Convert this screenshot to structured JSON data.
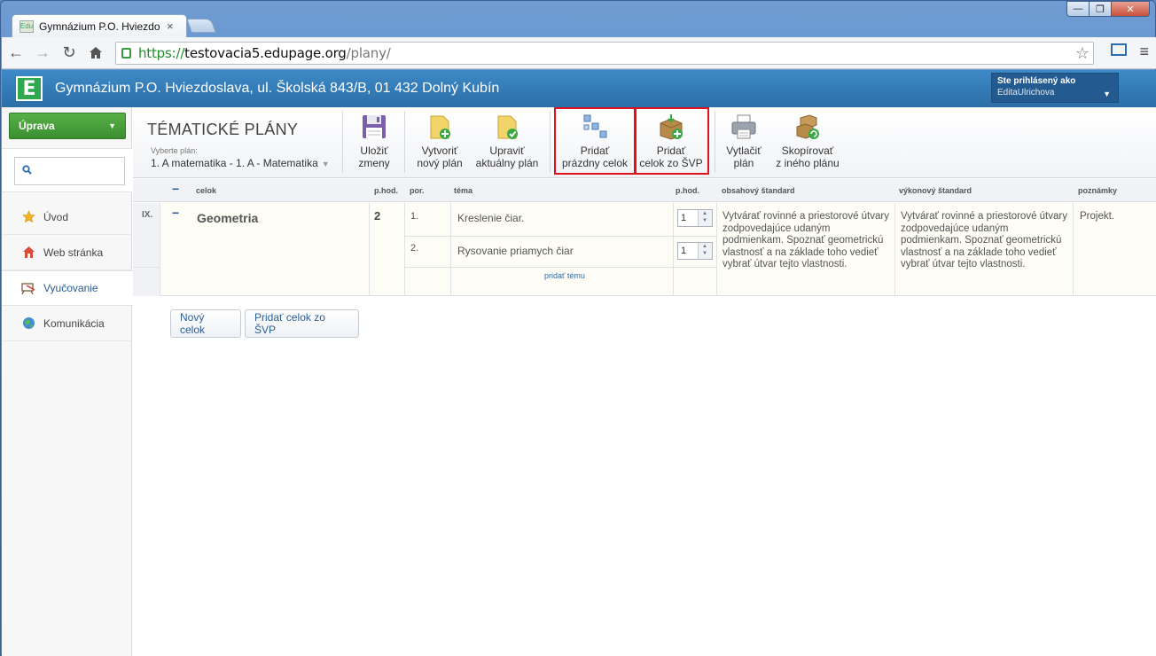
{
  "browser": {
    "tab_title": "Gymnázium P.O. Hviezdo",
    "favicon_text": "Edu",
    "close_glyph": "×",
    "window_buttons": [
      "—",
      "❐",
      "✕"
    ],
    "url_scheme": "https://",
    "url_host": "testovacia5.edupage.org",
    "url_path": "/plany/"
  },
  "header": {
    "logo_letter": "E",
    "school_name": "Gymnázium P.O. Hviezdoslava, ul. Školská 843/B, 01 432 Dolný Kubín",
    "user_label": "Ste prihlásený ako",
    "user_name": "EditaUlrichova"
  },
  "sidebar": {
    "uprava_label": "Úprava",
    "search_placeholder": "",
    "items": [
      {
        "label": "Úvod",
        "icon": "star-icon"
      },
      {
        "label": "Web stránka",
        "icon": "house-icon"
      },
      {
        "label": "Vyučovanie",
        "icon": "chalkboard-icon"
      },
      {
        "label": "Komunikácia",
        "icon": "people-icon"
      }
    ]
  },
  "ribbon": {
    "title": "TÉMATICKÉ PLÁNY",
    "select_label": "Vyberte plán:",
    "selected_plan": "1. A matematika - 1. A - Matematika",
    "buttons": {
      "save": [
        "Uložiť",
        "zmeny"
      ],
      "new_plan": [
        "Vytvoriť",
        "nový plán"
      ],
      "edit_plan": [
        "Upraviť",
        "aktuálny plán"
      ],
      "add_empty": [
        "Pridať",
        "prázdny celok"
      ],
      "add_svp": [
        "Pridať",
        "celok zo ŠVP"
      ],
      "print": [
        "Vytlačiť",
        "plán"
      ],
      "copy": [
        "Skopírovať",
        "z iného plánu"
      ]
    },
    "accent_color": "#e0121c"
  },
  "table": {
    "headers": {
      "celok": "celok",
      "phod": "p.hod.",
      "por": "por.",
      "tema": "téma",
      "phod2": "p.hod.",
      "obsahovy": "obsahový štandard",
      "vykonovy": "výkonový štandard",
      "poznamky": "poznámky"
    },
    "collapse_glyph": "−",
    "row": {
      "index": "IX.",
      "celok": "Geometria",
      "hours": "2",
      "topics": [
        {
          "order": "1.",
          "name": "Kreslenie čiar.",
          "hours": "1"
        },
        {
          "order": "2.",
          "name": "Rysovanie priamych čiar",
          "hours": "1"
        }
      ],
      "add_topic_label": "pridať tému",
      "obsahovy_standard": "Vytvárať rovinné a priestorové útvary zodpovedajúce udaným podmienkam.  Spoznať geometrickú vlastnosť a na základe toho vedieť vybrať útvar tejto vlastnosti.",
      "vykonovy_standard": "Vytvárať rovinné a priestorové útvary zodpovedajúce udaným podmienkam.  Spoznať geometrickú vlastnosť a na základe toho vedieť vybrať útvar tejto vlastnosti.",
      "poznamky": "Projekt."
    }
  },
  "footer_buttons": {
    "new_celok": "Nový celok",
    "add_svp": "Pridať celok zo ŠVP"
  }
}
